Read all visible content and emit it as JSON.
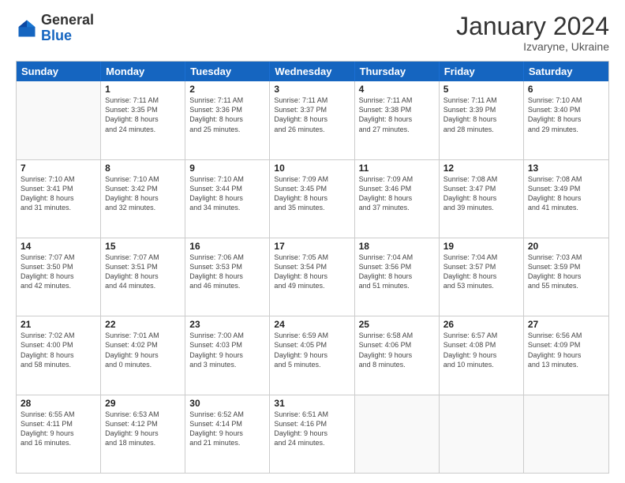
{
  "logo": {
    "general": "General",
    "blue": "Blue"
  },
  "header": {
    "month": "January 2024",
    "location": "Izvaryne, Ukraine"
  },
  "days": [
    "Sunday",
    "Monday",
    "Tuesday",
    "Wednesday",
    "Thursday",
    "Friday",
    "Saturday"
  ],
  "weeks": [
    [
      {
        "num": "",
        "lines": []
      },
      {
        "num": "1",
        "lines": [
          "Sunrise: 7:11 AM",
          "Sunset: 3:35 PM",
          "Daylight: 8 hours",
          "and 24 minutes."
        ]
      },
      {
        "num": "2",
        "lines": [
          "Sunrise: 7:11 AM",
          "Sunset: 3:36 PM",
          "Daylight: 8 hours",
          "and 25 minutes."
        ]
      },
      {
        "num": "3",
        "lines": [
          "Sunrise: 7:11 AM",
          "Sunset: 3:37 PM",
          "Daylight: 8 hours",
          "and 26 minutes."
        ]
      },
      {
        "num": "4",
        "lines": [
          "Sunrise: 7:11 AM",
          "Sunset: 3:38 PM",
          "Daylight: 8 hours",
          "and 27 minutes."
        ]
      },
      {
        "num": "5",
        "lines": [
          "Sunrise: 7:11 AM",
          "Sunset: 3:39 PM",
          "Daylight: 8 hours",
          "and 28 minutes."
        ]
      },
      {
        "num": "6",
        "lines": [
          "Sunrise: 7:10 AM",
          "Sunset: 3:40 PM",
          "Daylight: 8 hours",
          "and 29 minutes."
        ]
      }
    ],
    [
      {
        "num": "7",
        "lines": [
          "Sunrise: 7:10 AM",
          "Sunset: 3:41 PM",
          "Daylight: 8 hours",
          "and 31 minutes."
        ]
      },
      {
        "num": "8",
        "lines": [
          "Sunrise: 7:10 AM",
          "Sunset: 3:42 PM",
          "Daylight: 8 hours",
          "and 32 minutes."
        ]
      },
      {
        "num": "9",
        "lines": [
          "Sunrise: 7:10 AM",
          "Sunset: 3:44 PM",
          "Daylight: 8 hours",
          "and 34 minutes."
        ]
      },
      {
        "num": "10",
        "lines": [
          "Sunrise: 7:09 AM",
          "Sunset: 3:45 PM",
          "Daylight: 8 hours",
          "and 35 minutes."
        ]
      },
      {
        "num": "11",
        "lines": [
          "Sunrise: 7:09 AM",
          "Sunset: 3:46 PM",
          "Daylight: 8 hours",
          "and 37 minutes."
        ]
      },
      {
        "num": "12",
        "lines": [
          "Sunrise: 7:08 AM",
          "Sunset: 3:47 PM",
          "Daylight: 8 hours",
          "and 39 minutes."
        ]
      },
      {
        "num": "13",
        "lines": [
          "Sunrise: 7:08 AM",
          "Sunset: 3:49 PM",
          "Daylight: 8 hours",
          "and 41 minutes."
        ]
      }
    ],
    [
      {
        "num": "14",
        "lines": [
          "Sunrise: 7:07 AM",
          "Sunset: 3:50 PM",
          "Daylight: 8 hours",
          "and 42 minutes."
        ]
      },
      {
        "num": "15",
        "lines": [
          "Sunrise: 7:07 AM",
          "Sunset: 3:51 PM",
          "Daylight: 8 hours",
          "and 44 minutes."
        ]
      },
      {
        "num": "16",
        "lines": [
          "Sunrise: 7:06 AM",
          "Sunset: 3:53 PM",
          "Daylight: 8 hours",
          "and 46 minutes."
        ]
      },
      {
        "num": "17",
        "lines": [
          "Sunrise: 7:05 AM",
          "Sunset: 3:54 PM",
          "Daylight: 8 hours",
          "and 49 minutes."
        ]
      },
      {
        "num": "18",
        "lines": [
          "Sunrise: 7:04 AM",
          "Sunset: 3:56 PM",
          "Daylight: 8 hours",
          "and 51 minutes."
        ]
      },
      {
        "num": "19",
        "lines": [
          "Sunrise: 7:04 AM",
          "Sunset: 3:57 PM",
          "Daylight: 8 hours",
          "and 53 minutes."
        ]
      },
      {
        "num": "20",
        "lines": [
          "Sunrise: 7:03 AM",
          "Sunset: 3:59 PM",
          "Daylight: 8 hours",
          "and 55 minutes."
        ]
      }
    ],
    [
      {
        "num": "21",
        "lines": [
          "Sunrise: 7:02 AM",
          "Sunset: 4:00 PM",
          "Daylight: 8 hours",
          "and 58 minutes."
        ]
      },
      {
        "num": "22",
        "lines": [
          "Sunrise: 7:01 AM",
          "Sunset: 4:02 PM",
          "Daylight: 9 hours",
          "and 0 minutes."
        ]
      },
      {
        "num": "23",
        "lines": [
          "Sunrise: 7:00 AM",
          "Sunset: 4:03 PM",
          "Daylight: 9 hours",
          "and 3 minutes."
        ]
      },
      {
        "num": "24",
        "lines": [
          "Sunrise: 6:59 AM",
          "Sunset: 4:05 PM",
          "Daylight: 9 hours",
          "and 5 minutes."
        ]
      },
      {
        "num": "25",
        "lines": [
          "Sunrise: 6:58 AM",
          "Sunset: 4:06 PM",
          "Daylight: 9 hours",
          "and 8 minutes."
        ]
      },
      {
        "num": "26",
        "lines": [
          "Sunrise: 6:57 AM",
          "Sunset: 4:08 PM",
          "Daylight: 9 hours",
          "and 10 minutes."
        ]
      },
      {
        "num": "27",
        "lines": [
          "Sunrise: 6:56 AM",
          "Sunset: 4:09 PM",
          "Daylight: 9 hours",
          "and 13 minutes."
        ]
      }
    ],
    [
      {
        "num": "28",
        "lines": [
          "Sunrise: 6:55 AM",
          "Sunset: 4:11 PM",
          "Daylight: 9 hours",
          "and 16 minutes."
        ]
      },
      {
        "num": "29",
        "lines": [
          "Sunrise: 6:53 AM",
          "Sunset: 4:12 PM",
          "Daylight: 9 hours",
          "and 18 minutes."
        ]
      },
      {
        "num": "30",
        "lines": [
          "Sunrise: 6:52 AM",
          "Sunset: 4:14 PM",
          "Daylight: 9 hours",
          "and 21 minutes."
        ]
      },
      {
        "num": "31",
        "lines": [
          "Sunrise: 6:51 AM",
          "Sunset: 4:16 PM",
          "Daylight: 9 hours",
          "and 24 minutes."
        ]
      },
      {
        "num": "",
        "lines": []
      },
      {
        "num": "",
        "lines": []
      },
      {
        "num": "",
        "lines": []
      }
    ]
  ]
}
